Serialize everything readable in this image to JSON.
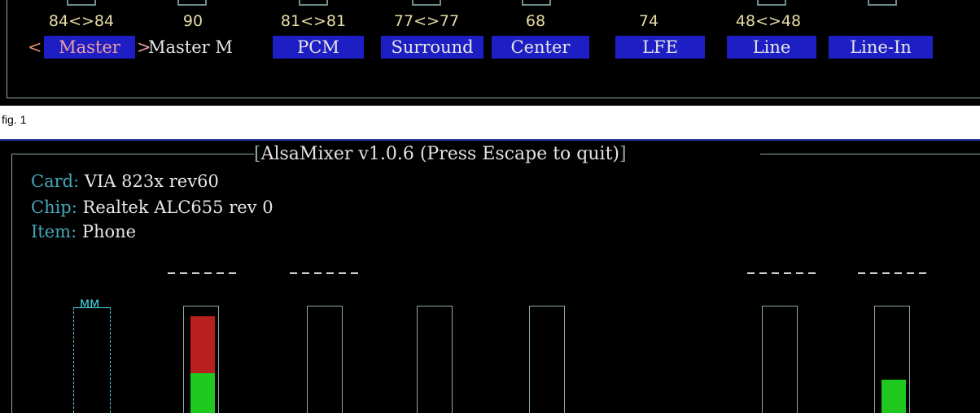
{
  "fig1": {
    "caption": "fig. 1",
    "channels": [
      {
        "value": "84<>84",
        "label": "Master",
        "selected": true
      },
      {
        "value": "90",
        "label": "Master M",
        "selected": false
      },
      {
        "value": "81<>81",
        "label": "PCM",
        "selected": false
      },
      {
        "value": "77<>77",
        "label": "Surround",
        "selected": false
      },
      {
        "value": "68",
        "label": "Center",
        "selected": false
      },
      {
        "value": "74",
        "label": "LFE",
        "selected": false
      },
      {
        "value": "48<>48",
        "label": "Line",
        "selected": false
      },
      {
        "value": "",
        "label": "Line-In",
        "selected": false
      }
    ],
    "arrow_left": "<",
    "arrow_right": ">"
  },
  "fig2": {
    "title": "AlsaMixer v1.0.6 (Press Escape to quit)",
    "card_key": "Card:",
    "card_value": "VIA 823x rev60",
    "chip_key": "Chip:",
    "chip_value": "Realtek ALC655 rev 0",
    "item_key": "Item:",
    "item_value": "Phone",
    "mm_label": "MM",
    "sliders": [
      {
        "name": "slider-2",
        "red_level": 0.9,
        "green_level": 0.35
      },
      {
        "name": "slider-3",
        "red_level": 0,
        "green_level": 0
      },
      {
        "name": "slider-4",
        "red_level": 0,
        "green_level": 0
      },
      {
        "name": "slider-5",
        "red_level": 0,
        "green_level": 0
      },
      {
        "name": "slider-6",
        "red_level": 0,
        "green_level": 0
      },
      {
        "name": "slider-7",
        "red_level": 0,
        "green_level": 0.35
      }
    ]
  },
  "colors": {
    "terminal_bg": "#000000",
    "label_bg": "#1d1fc4",
    "value_text": "#e8dca6",
    "border": "#8fa8a8",
    "key_text": "#45a8b8",
    "red_bar": "#b82020",
    "green_bar": "#1ec81e"
  }
}
